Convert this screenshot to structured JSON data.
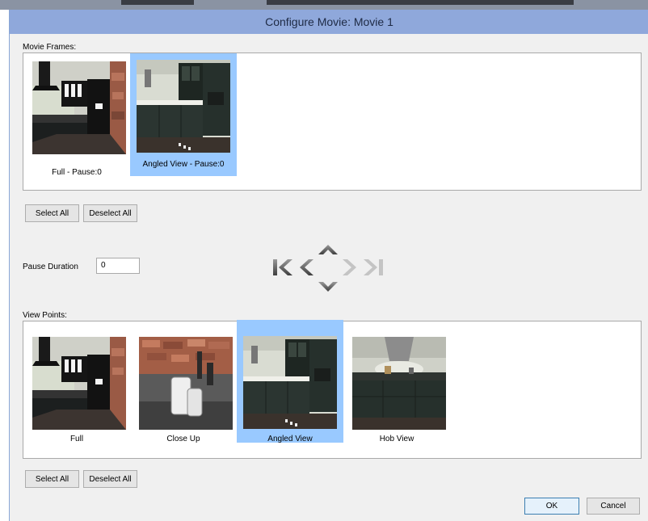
{
  "dialog": {
    "title": "Configure Movie: Movie 1"
  },
  "movie_frames": {
    "label": "Movie Frames:",
    "items": [
      {
        "caption": "Full - Pause:0",
        "selected": false,
        "image": "full-kitchen-view"
      },
      {
        "caption": "Angled View - Pause:0",
        "selected": true,
        "image": "angled-kitchen-view"
      }
    ],
    "select_all": "Select All",
    "deselect_all": "Deselect All"
  },
  "pause": {
    "label": "Pause Duration",
    "value": "0"
  },
  "navigation": {
    "icons": [
      "first-frame-icon",
      "previous-frame-icon",
      "move-up-icon",
      "move-down-icon",
      "next-frame-icon",
      "last-frame-icon"
    ]
  },
  "view_points": {
    "label": "View Points:",
    "items": [
      {
        "caption": "Full",
        "selected": false,
        "image": "full-kitchen-view"
      },
      {
        "caption": "Close Up",
        "selected": false,
        "image": "close-up-vases-view"
      },
      {
        "caption": "Angled View",
        "selected": true,
        "image": "angled-kitchen-view"
      },
      {
        "caption": "Hob View",
        "selected": false,
        "image": "hob-kitchen-view"
      }
    ],
    "select_all": "Select All",
    "deselect_all": "Deselect All"
  },
  "footer": {
    "ok": "OK",
    "cancel": "Cancel"
  },
  "colors": {
    "title_bar": "#8fa8db",
    "selection": "#99c9ff",
    "cabinet": "#26302c"
  }
}
